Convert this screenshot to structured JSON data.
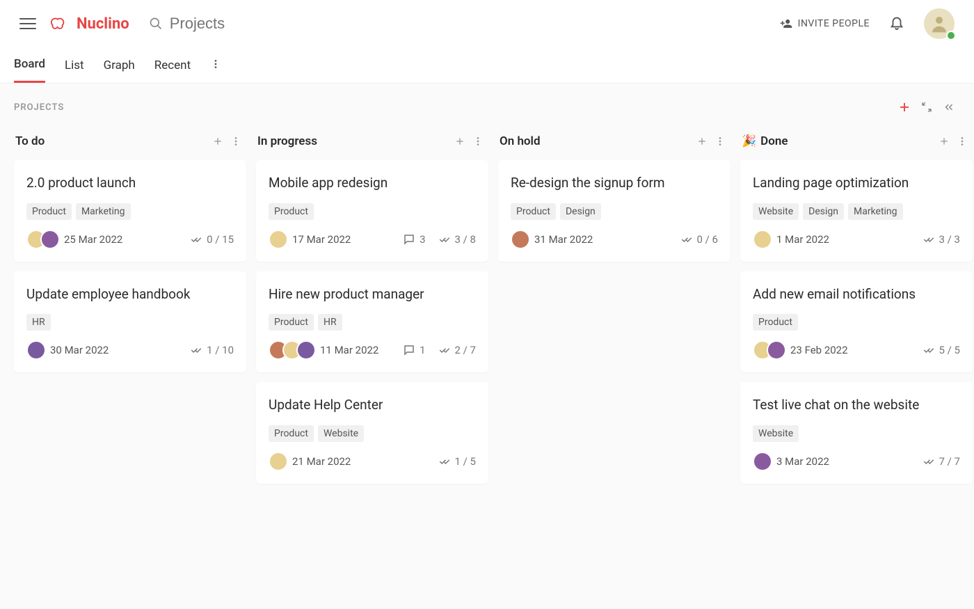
{
  "app": {
    "name": "Nuclino"
  },
  "search": {
    "placeholder": "Projects"
  },
  "topbar": {
    "invite_label": "INVITE PEOPLE"
  },
  "tabs": [
    "Board",
    "List",
    "Graph",
    "Recent"
  ],
  "active_tab": 0,
  "page_label": "PROJECTS",
  "columns": [
    {
      "title": "To do",
      "icon": "",
      "cards": [
        {
          "title": "2.0 product launch",
          "tags": [
            "Product",
            "Marketing"
          ],
          "avatars": [
            "av1",
            "av2"
          ],
          "date": "25 Mar 2022",
          "comments": null,
          "checklist": "0 / 15"
        },
        {
          "title": "Update employee handbook",
          "tags": [
            "HR"
          ],
          "avatars": [
            "av4"
          ],
          "date": "30 Mar 2022",
          "comments": null,
          "checklist": "1 / 10"
        }
      ]
    },
    {
      "title": "In progress",
      "icon": "",
      "cards": [
        {
          "title": "Mobile app redesign",
          "tags": [
            "Product"
          ],
          "avatars": [
            "av1"
          ],
          "date": "17 Mar 2022",
          "comments": "3",
          "checklist": "3 / 8"
        },
        {
          "title": "Hire new product manager",
          "tags": [
            "Product",
            "HR"
          ],
          "avatars": [
            "av3",
            "av1",
            "av4"
          ],
          "date": "11 Mar 2022",
          "comments": "1",
          "checklist": "2 / 7"
        },
        {
          "title": "Update Help Center",
          "tags": [
            "Product",
            "Website"
          ],
          "avatars": [
            "av1"
          ],
          "date": "21 Mar 2022",
          "comments": null,
          "checklist": "1 / 5"
        }
      ]
    },
    {
      "title": "On hold",
      "icon": "",
      "cards": [
        {
          "title": "Re-design the signup form",
          "tags": [
            "Product",
            "Design"
          ],
          "avatars": [
            "av3"
          ],
          "date": "31 Mar 2022",
          "comments": null,
          "checklist": "0 / 6"
        }
      ]
    },
    {
      "title": "Done",
      "icon": "🎉",
      "cards": [
        {
          "title": "Landing page optimization",
          "tags": [
            "Website",
            "Design",
            "Marketing"
          ],
          "avatars": [
            "av1"
          ],
          "date": "1 Mar 2022",
          "comments": null,
          "checklist": "3 / 3"
        },
        {
          "title": "Add new email notifications",
          "tags": [
            "Product"
          ],
          "avatars": [
            "av1",
            "av2"
          ],
          "date": "23 Feb 2022",
          "comments": null,
          "checklist": "5 / 5"
        },
        {
          "title": "Test live chat on the website",
          "tags": [
            "Website"
          ],
          "avatars": [
            "av2"
          ],
          "date": "3 Mar 2022",
          "comments": null,
          "checklist": "7 / 7"
        }
      ]
    }
  ]
}
